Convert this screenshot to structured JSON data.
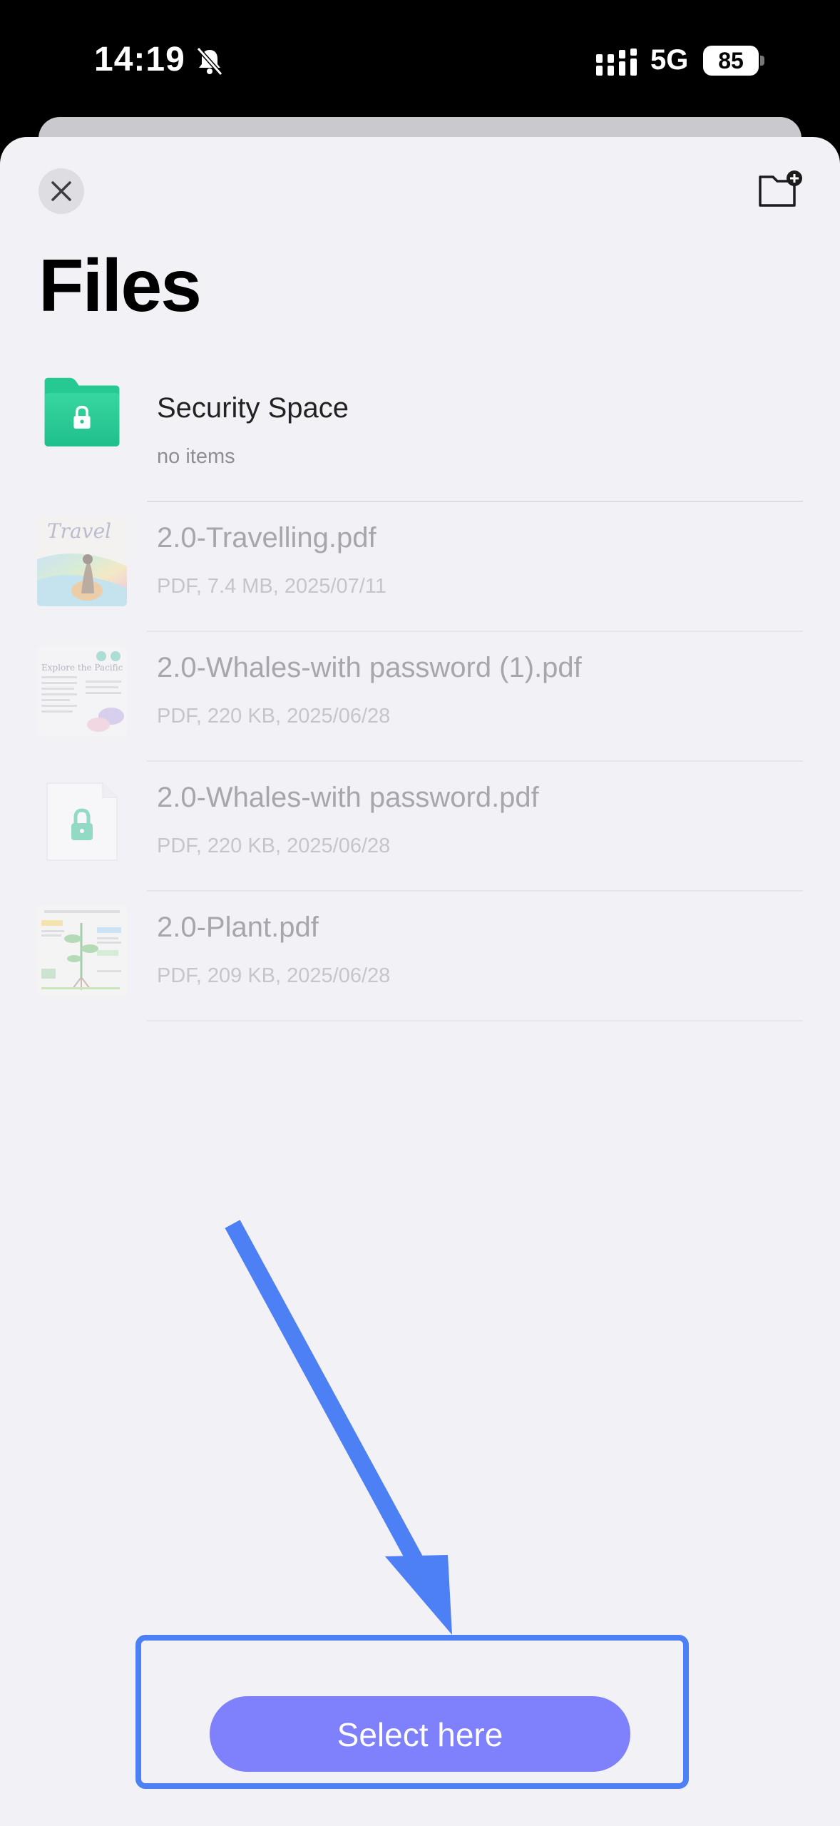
{
  "status_bar": {
    "time": "14:19",
    "network": "5G",
    "battery": "85"
  },
  "header": {
    "title": "Files",
    "close_icon": "close-icon",
    "new_folder_icon": "new-folder-icon"
  },
  "files": [
    {
      "name": "Security Space",
      "meta": "no items",
      "type": "folder",
      "enabled": true
    },
    {
      "name": "2.0-Travelling.pdf",
      "meta": "PDF, 7.4 MB, 2025/07/11",
      "type": "pdf",
      "enabled": false
    },
    {
      "name": "2.0-Whales-with password (1).pdf",
      "meta": "PDF, 220 KB, 2025/06/28",
      "type": "pdf",
      "enabled": false
    },
    {
      "name": "2.0-Whales-with password.pdf",
      "meta": "PDF, 220 KB, 2025/06/28",
      "type": "locked-pdf",
      "enabled": false
    },
    {
      "name": "2.0-Plant.pdf",
      "meta": "PDF, 209 KB, 2025/06/28",
      "type": "pdf",
      "enabled": false
    }
  ],
  "thumbnails": {
    "travel_title": "Travel",
    "whales_title": "Explore the Pacific"
  },
  "action": {
    "select_label": "Select here"
  },
  "colors": {
    "folder_green": "#2fcf9a",
    "button_purple": "#7f80fb",
    "annotation_blue": "#4d7ff5",
    "sheet_background": "#f2f1f6"
  }
}
